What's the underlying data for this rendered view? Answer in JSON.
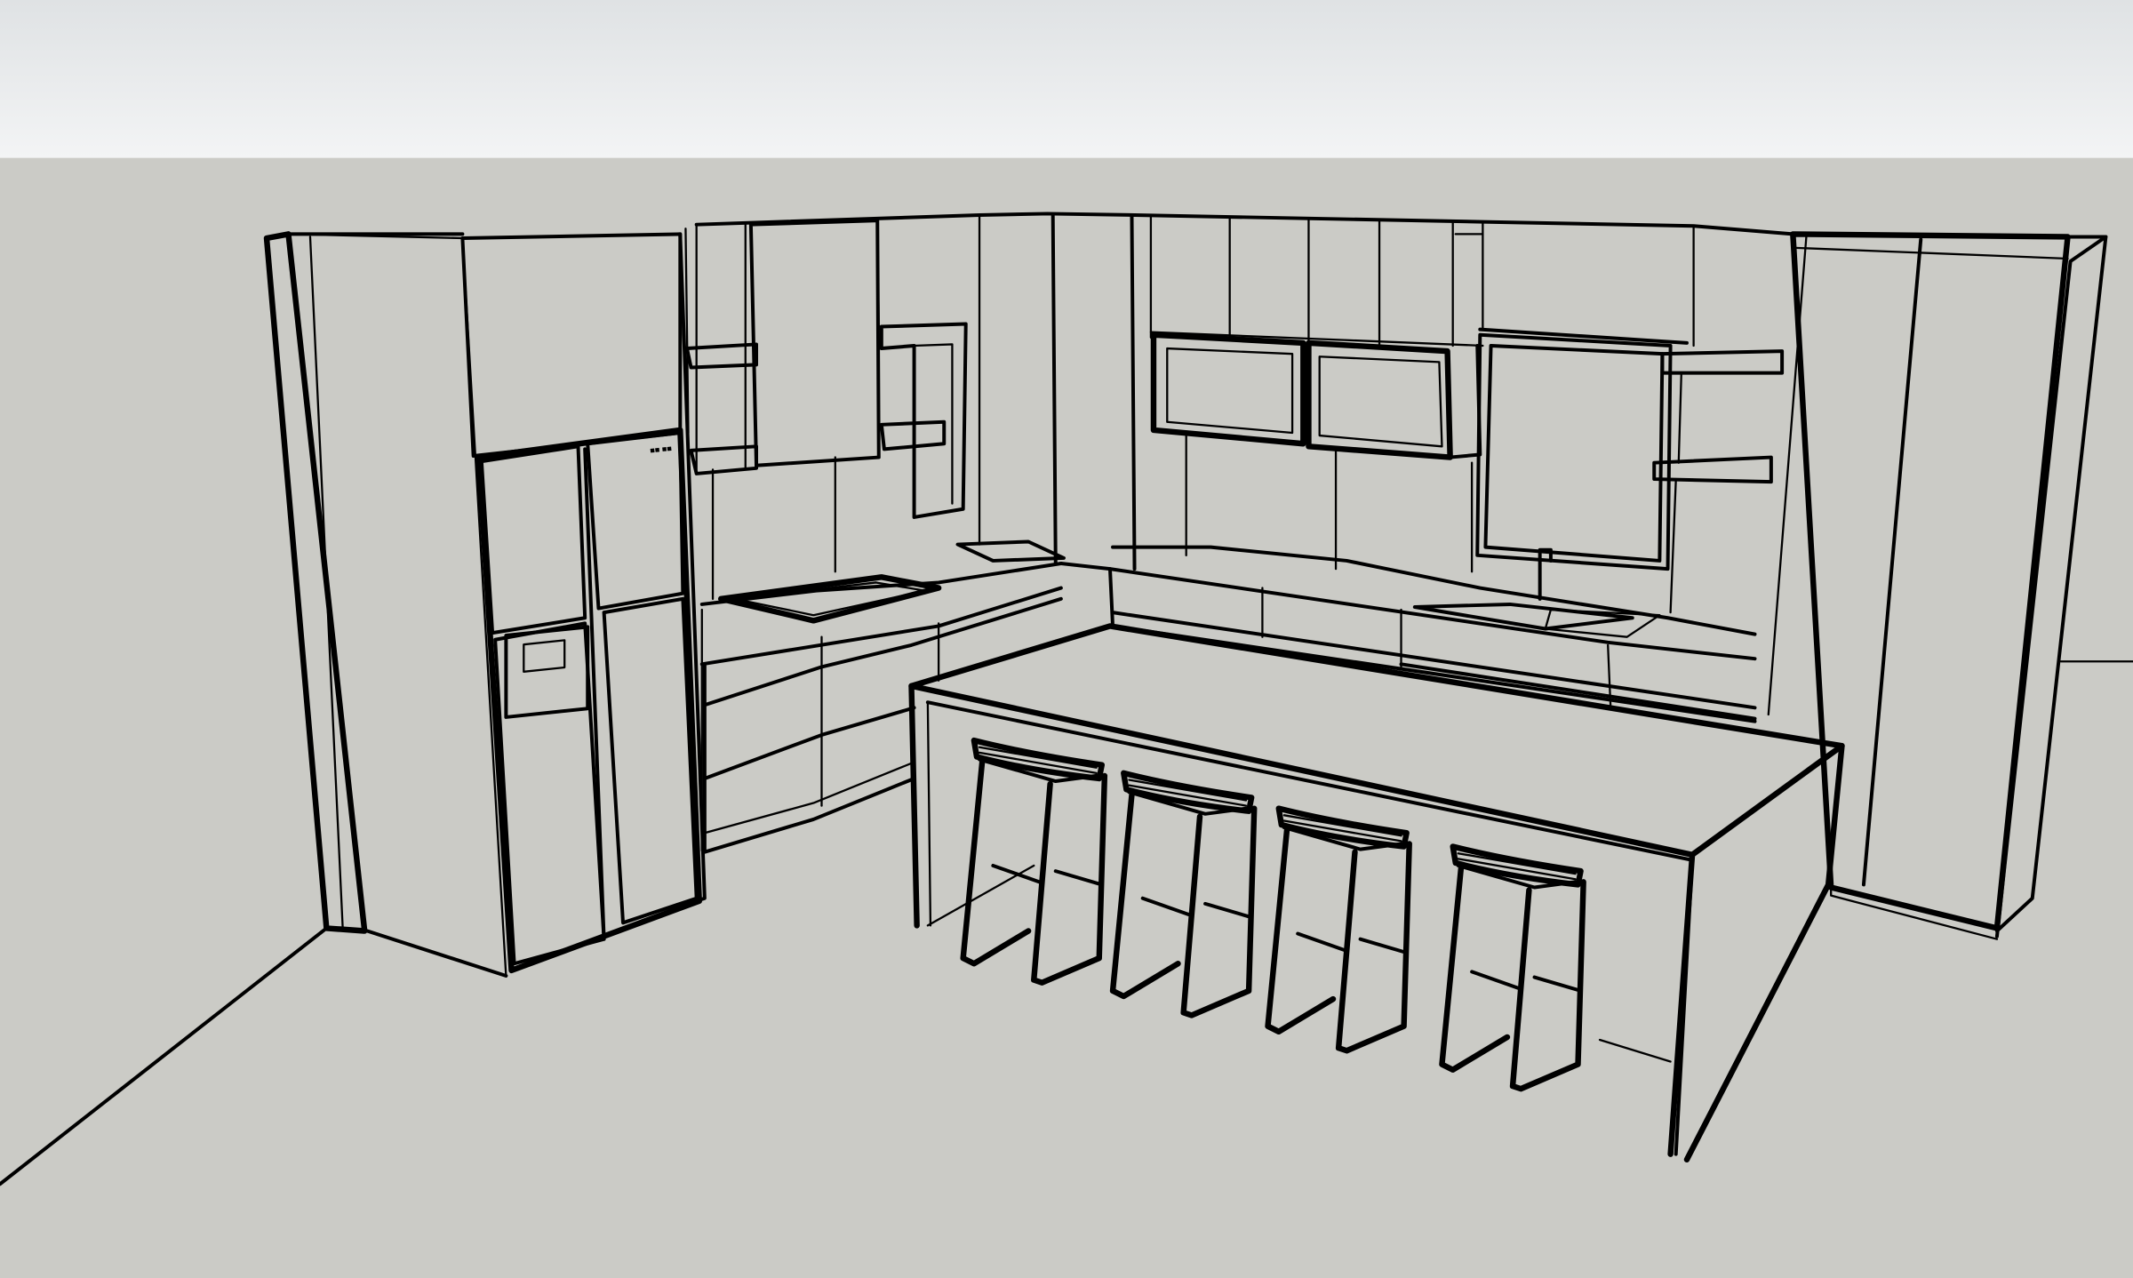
{
  "scene": {
    "sky_color_top": "#dfe2e4",
    "sky_color_bottom": "#f3f4f5",
    "ground_color": "#cbcbc6",
    "line_color": "#000000",
    "counter_stools": 4
  }
}
